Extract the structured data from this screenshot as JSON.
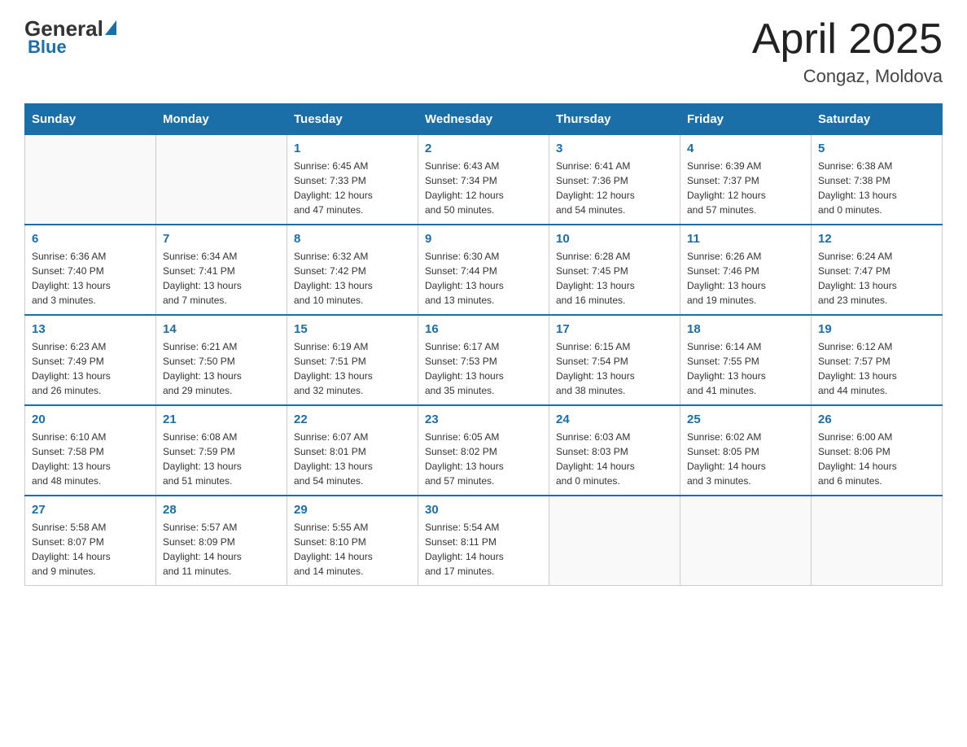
{
  "header": {
    "logo": {
      "general": "General",
      "blue": "Blue"
    },
    "title": "April 2025",
    "location": "Congaz, Moldova"
  },
  "weekdays": [
    "Sunday",
    "Monday",
    "Tuesday",
    "Wednesday",
    "Thursday",
    "Friday",
    "Saturday"
  ],
  "weeks": [
    [
      {
        "day": "",
        "info": ""
      },
      {
        "day": "",
        "info": ""
      },
      {
        "day": "1",
        "info": "Sunrise: 6:45 AM\nSunset: 7:33 PM\nDaylight: 12 hours\nand 47 minutes."
      },
      {
        "day": "2",
        "info": "Sunrise: 6:43 AM\nSunset: 7:34 PM\nDaylight: 12 hours\nand 50 minutes."
      },
      {
        "day": "3",
        "info": "Sunrise: 6:41 AM\nSunset: 7:36 PM\nDaylight: 12 hours\nand 54 minutes."
      },
      {
        "day": "4",
        "info": "Sunrise: 6:39 AM\nSunset: 7:37 PM\nDaylight: 12 hours\nand 57 minutes."
      },
      {
        "day": "5",
        "info": "Sunrise: 6:38 AM\nSunset: 7:38 PM\nDaylight: 13 hours\nand 0 minutes."
      }
    ],
    [
      {
        "day": "6",
        "info": "Sunrise: 6:36 AM\nSunset: 7:40 PM\nDaylight: 13 hours\nand 3 minutes."
      },
      {
        "day": "7",
        "info": "Sunrise: 6:34 AM\nSunset: 7:41 PM\nDaylight: 13 hours\nand 7 minutes."
      },
      {
        "day": "8",
        "info": "Sunrise: 6:32 AM\nSunset: 7:42 PM\nDaylight: 13 hours\nand 10 minutes."
      },
      {
        "day": "9",
        "info": "Sunrise: 6:30 AM\nSunset: 7:44 PM\nDaylight: 13 hours\nand 13 minutes."
      },
      {
        "day": "10",
        "info": "Sunrise: 6:28 AM\nSunset: 7:45 PM\nDaylight: 13 hours\nand 16 minutes."
      },
      {
        "day": "11",
        "info": "Sunrise: 6:26 AM\nSunset: 7:46 PM\nDaylight: 13 hours\nand 19 minutes."
      },
      {
        "day": "12",
        "info": "Sunrise: 6:24 AM\nSunset: 7:47 PM\nDaylight: 13 hours\nand 23 minutes."
      }
    ],
    [
      {
        "day": "13",
        "info": "Sunrise: 6:23 AM\nSunset: 7:49 PM\nDaylight: 13 hours\nand 26 minutes."
      },
      {
        "day": "14",
        "info": "Sunrise: 6:21 AM\nSunset: 7:50 PM\nDaylight: 13 hours\nand 29 minutes."
      },
      {
        "day": "15",
        "info": "Sunrise: 6:19 AM\nSunset: 7:51 PM\nDaylight: 13 hours\nand 32 minutes."
      },
      {
        "day": "16",
        "info": "Sunrise: 6:17 AM\nSunset: 7:53 PM\nDaylight: 13 hours\nand 35 minutes."
      },
      {
        "day": "17",
        "info": "Sunrise: 6:15 AM\nSunset: 7:54 PM\nDaylight: 13 hours\nand 38 minutes."
      },
      {
        "day": "18",
        "info": "Sunrise: 6:14 AM\nSunset: 7:55 PM\nDaylight: 13 hours\nand 41 minutes."
      },
      {
        "day": "19",
        "info": "Sunrise: 6:12 AM\nSunset: 7:57 PM\nDaylight: 13 hours\nand 44 minutes."
      }
    ],
    [
      {
        "day": "20",
        "info": "Sunrise: 6:10 AM\nSunset: 7:58 PM\nDaylight: 13 hours\nand 48 minutes."
      },
      {
        "day": "21",
        "info": "Sunrise: 6:08 AM\nSunset: 7:59 PM\nDaylight: 13 hours\nand 51 minutes."
      },
      {
        "day": "22",
        "info": "Sunrise: 6:07 AM\nSunset: 8:01 PM\nDaylight: 13 hours\nand 54 minutes."
      },
      {
        "day": "23",
        "info": "Sunrise: 6:05 AM\nSunset: 8:02 PM\nDaylight: 13 hours\nand 57 minutes."
      },
      {
        "day": "24",
        "info": "Sunrise: 6:03 AM\nSunset: 8:03 PM\nDaylight: 14 hours\nand 0 minutes."
      },
      {
        "day": "25",
        "info": "Sunrise: 6:02 AM\nSunset: 8:05 PM\nDaylight: 14 hours\nand 3 minutes."
      },
      {
        "day": "26",
        "info": "Sunrise: 6:00 AM\nSunset: 8:06 PM\nDaylight: 14 hours\nand 6 minutes."
      }
    ],
    [
      {
        "day": "27",
        "info": "Sunrise: 5:58 AM\nSunset: 8:07 PM\nDaylight: 14 hours\nand 9 minutes."
      },
      {
        "day": "28",
        "info": "Sunrise: 5:57 AM\nSunset: 8:09 PM\nDaylight: 14 hours\nand 11 minutes."
      },
      {
        "day": "29",
        "info": "Sunrise: 5:55 AM\nSunset: 8:10 PM\nDaylight: 14 hours\nand 14 minutes."
      },
      {
        "day": "30",
        "info": "Sunrise: 5:54 AM\nSunset: 8:11 PM\nDaylight: 14 hours\nand 17 minutes."
      },
      {
        "day": "",
        "info": ""
      },
      {
        "day": "",
        "info": ""
      },
      {
        "day": "",
        "info": ""
      }
    ]
  ]
}
